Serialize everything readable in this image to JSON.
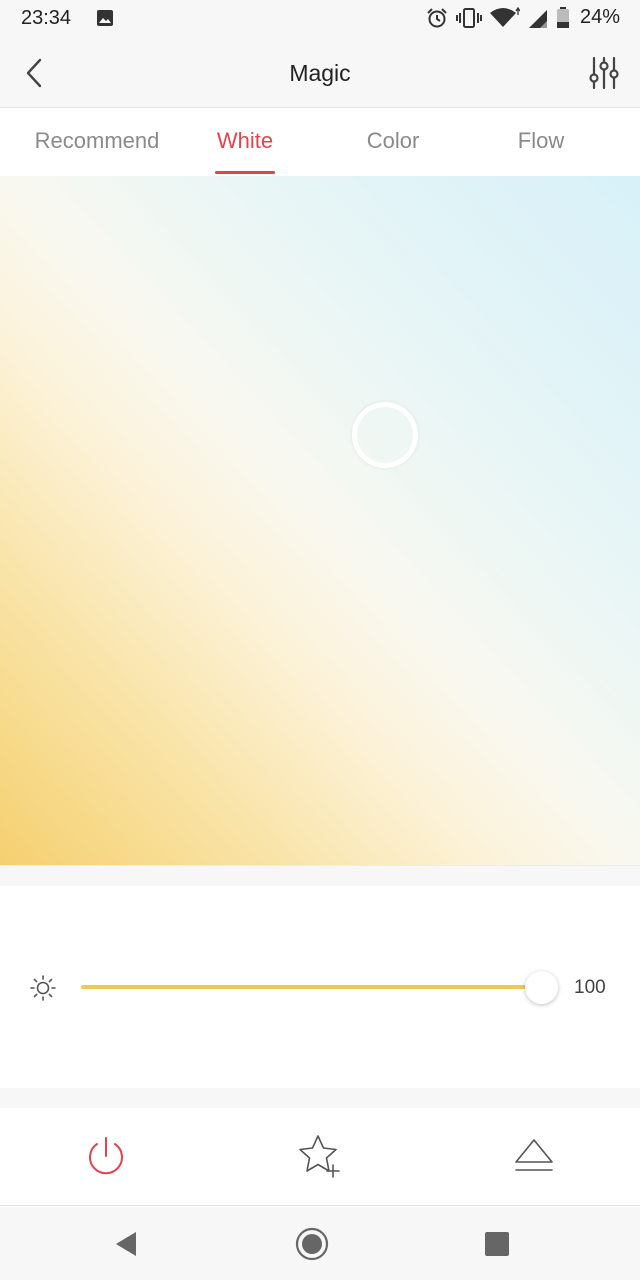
{
  "status_bar": {
    "time": "23:34",
    "battery_percent": "24%",
    "icons": [
      "image-icon",
      "alarm-icon",
      "vibrate-icon",
      "wifi-icon",
      "signal-icon",
      "battery-icon"
    ]
  },
  "header": {
    "title": "Magic",
    "back_icon": "chevron-left-icon",
    "settings_icon": "sliders-icon"
  },
  "tabs": [
    {
      "label": "Recommend",
      "active": false
    },
    {
      "label": "White",
      "active": true
    },
    {
      "label": "Color",
      "active": false
    },
    {
      "label": "Flow",
      "active": false
    }
  ],
  "colors": {
    "accent": "#e0454f",
    "slider": "#f3c458",
    "warm": "#f5d070",
    "cool": "#d7f1f8"
  },
  "brightness": {
    "value": "100",
    "level": 1.0,
    "icon": "sun-icon"
  },
  "actions": [
    {
      "icon": "power-icon"
    },
    {
      "icon": "star-add-icon"
    },
    {
      "icon": "eject-icon"
    }
  ],
  "nav": [
    {
      "icon": "nav-back-icon"
    },
    {
      "icon": "nav-home-icon"
    },
    {
      "icon": "nav-recents-icon"
    }
  ]
}
